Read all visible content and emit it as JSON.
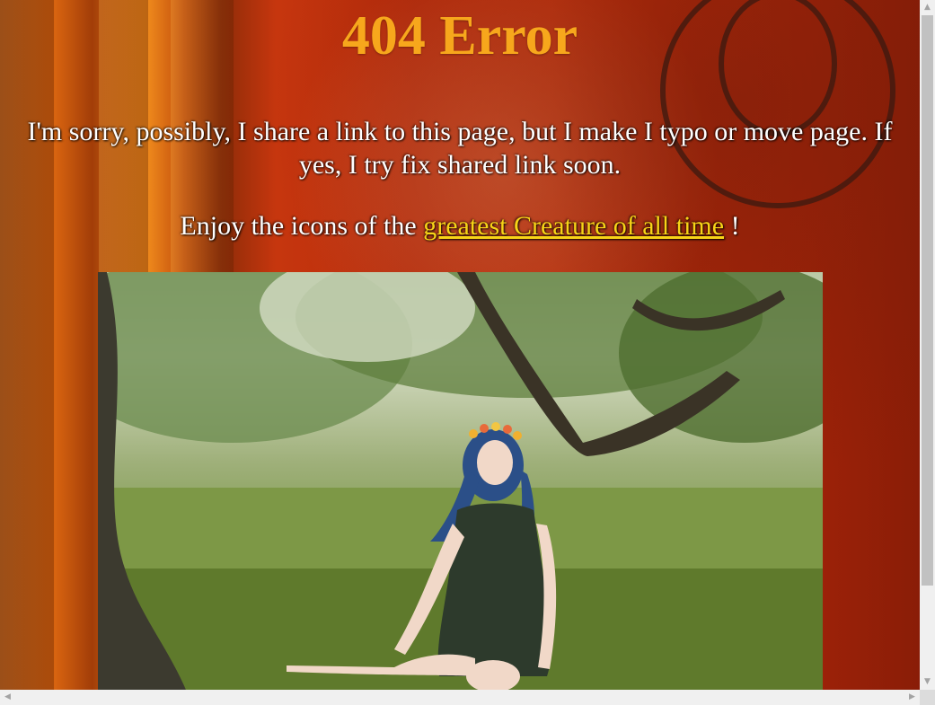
{
  "page": {
    "title": "404 Error",
    "message": "I'm sorry, possibly, I share a link to this page, but I make I typo or move page. If yes, I try fix shared link soon.",
    "enjoy_prefix": "Enjoy the icons of the ",
    "link_text": "greatest Creature of all time",
    "enjoy_suffix": " !"
  },
  "photo": {
    "alt": "girl with blue hair and flower crown sitting in grass under a tree"
  },
  "colors": {
    "title": "#f7a71c",
    "link": "#f8d417",
    "text": "#ffffff"
  },
  "scrollbar": {
    "up_arrow": "up-arrow-icon",
    "down_arrow": "down-arrow-icon",
    "left_arrow": "left-arrow-icon",
    "right_arrow": "right-arrow-icon"
  }
}
